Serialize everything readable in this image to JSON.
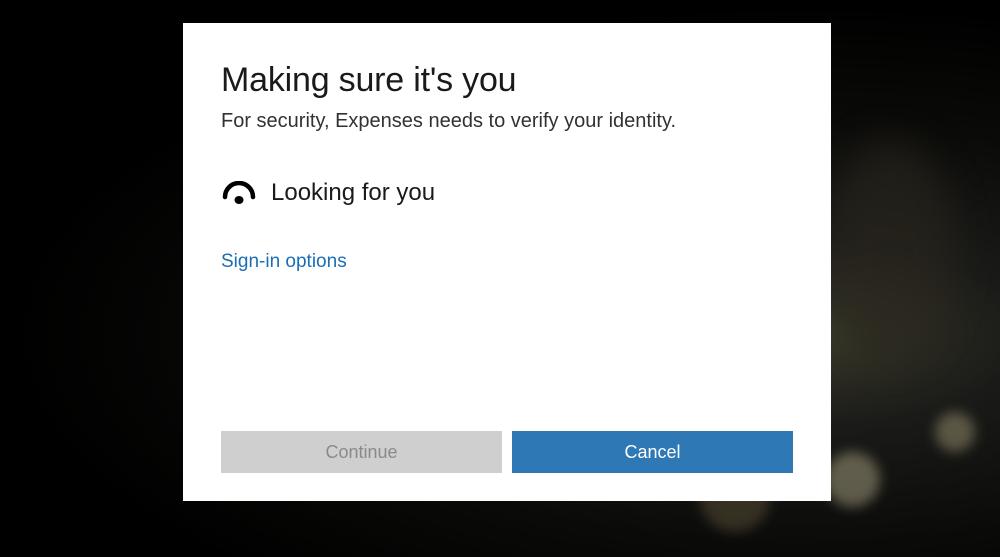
{
  "dialog": {
    "title": "Making sure it's you",
    "subtitle": "For security, Expenses needs to verify your identity.",
    "status": {
      "icon": "looking-eye-icon",
      "text": "Looking for you"
    },
    "sign_in_options_label": "Sign-in options",
    "buttons": {
      "continue_label": "Continue",
      "continue_enabled": false,
      "cancel_label": "Cancel"
    }
  },
  "colors": {
    "accent": "#2e78b6",
    "link": "#1b6eb6",
    "disabled_bg": "#cfcfcf",
    "disabled_fg": "#8a8a8a"
  }
}
